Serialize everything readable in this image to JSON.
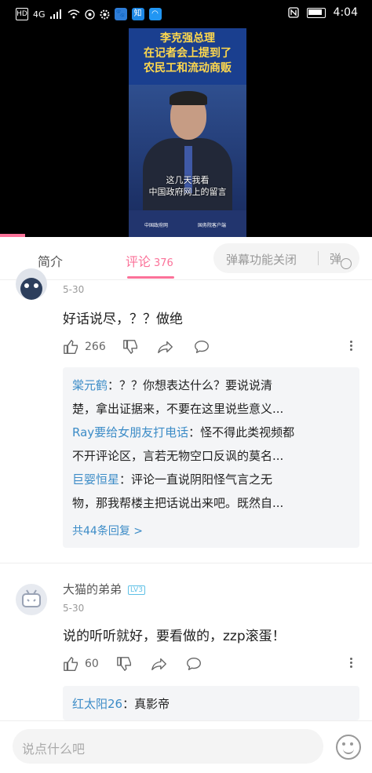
{
  "status_bar": {
    "left_badges": [
      "HD",
      "4G"
    ],
    "app_icons": [
      "baidu-icon",
      "zhihu-icon",
      "browser-icon"
    ],
    "zhihu_label": "知",
    "time": "4:04"
  },
  "video": {
    "title_lines": [
      "李克强总理",
      "在记者会上提到了",
      "农民工和流动商贩"
    ],
    "subtitle_lines": [
      "这几天我看",
      "中国政府网上的留言"
    ],
    "footer_left": "中国政府网",
    "footer_right": "国务院客户端",
    "progress_fraction": 0.07
  },
  "tabs": {
    "intro": "简介",
    "comments": "评论",
    "comment_count": "376",
    "danmaku": "弹幕功能关闭",
    "danmaku_icon_char": "弹"
  },
  "comments": [
    {
      "date": "5-30",
      "text": "好话说尽，？？做绝",
      "likes": "266",
      "replies": [
        {
          "name": "棠元鹤",
          "lines": [
            "：？？你想表达什么？要说说清",
            "楚，拿出证据来，不要在这里说些意义..."
          ]
        },
        {
          "name": "Ray要给女朋友打电话",
          "lines": [
            "：怪不得此类视频都",
            "不开评论区，言若无物空口反讽的莫名..."
          ]
        },
        {
          "name": "巨婴恒星",
          "lines": [
            "：评论一直说阴阳怪气言之无",
            "物，那我帮楼主把话说出来吧。既然自..."
          ]
        }
      ],
      "more_replies": "共44条回复 >"
    },
    {
      "username": "大猫的弟弟",
      "level": "LV3",
      "date": "5-30",
      "text": "说的听听就好，要看做的，zzp滚蛋！",
      "likes": "60",
      "replies": [
        {
          "name": "红太阳26",
          "lines": [
            "：真影帝"
          ]
        }
      ]
    }
  ],
  "input": {
    "placeholder": "说点什么吧"
  },
  "colors": {
    "accent": "#fb7299",
    "link": "#3c8cc7",
    "video_title": "#ffd84d"
  }
}
